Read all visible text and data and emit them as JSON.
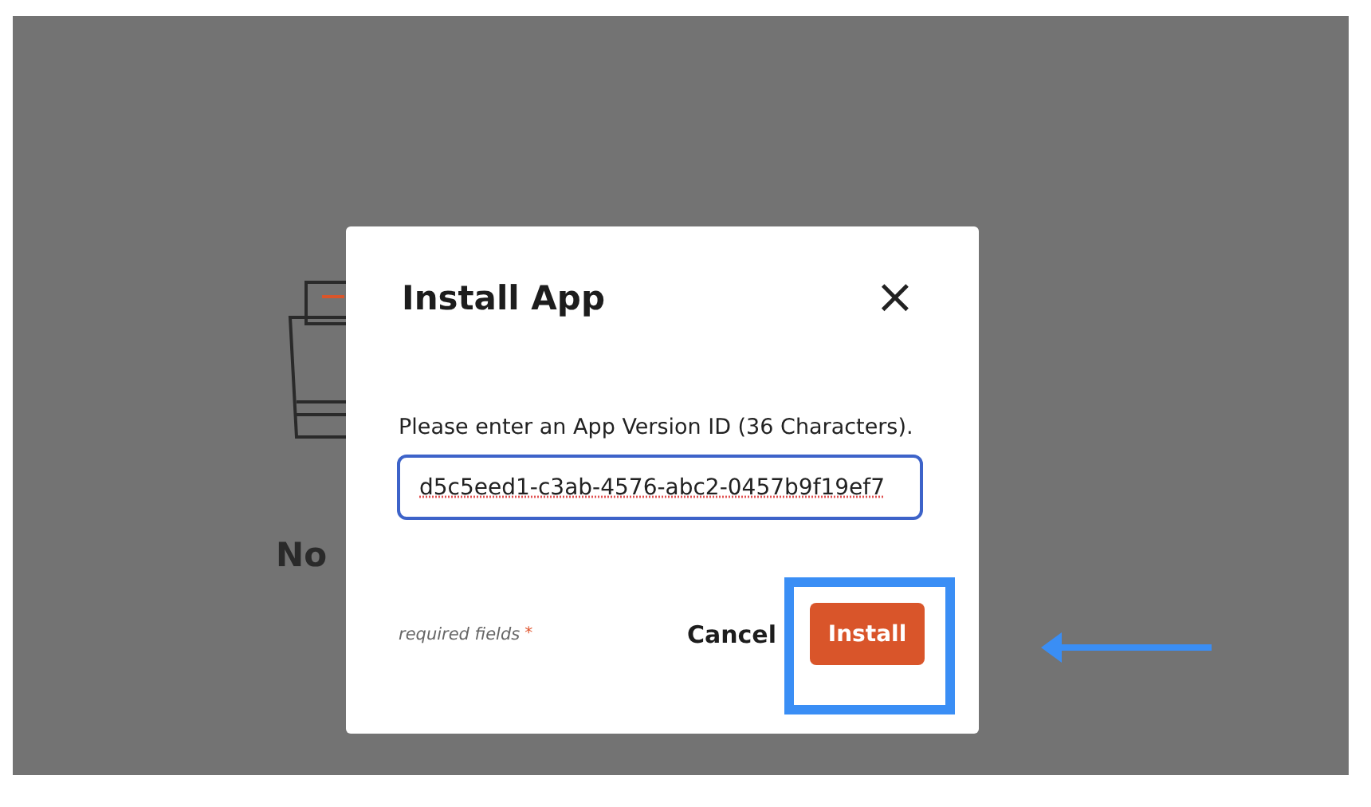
{
  "background": {
    "empty_title": "No"
  },
  "dialog": {
    "title": "Install App",
    "close_label": "×",
    "field_label": "Please enter an App Version ID (36 Characters).",
    "field_value": "d5c5eed1-c3ab-4576-abc2-0457b9f19ef7",
    "required_note": "required fields",
    "required_mark": "*",
    "buttons": [
      {
        "label": "Cancel",
        "kind": "text"
      },
      {
        "label": "Install",
        "kind": "primary"
      }
    ]
  },
  "annotation": {
    "highlight": true
  }
}
